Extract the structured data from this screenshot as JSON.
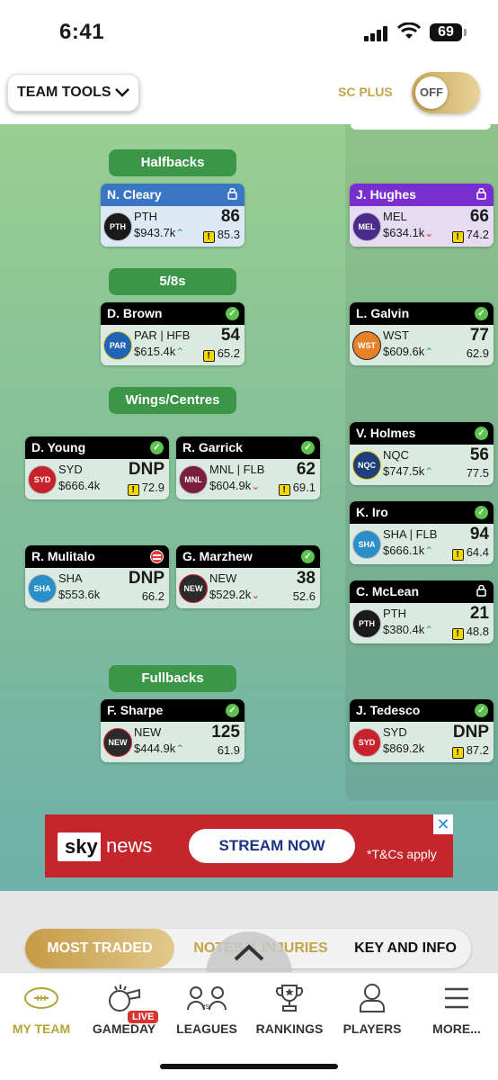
{
  "status": {
    "time": "6:41",
    "battery": "69"
  },
  "header": {
    "team_tools": "TEAM TOOLS",
    "sc_plus": "SC PLUS",
    "toggle": "OFF"
  },
  "positions": {
    "halfbacks": "Halfbacks",
    "five_eighths": "5/8s",
    "wings": "Wings/Centres",
    "fullbacks": "Fullbacks"
  },
  "players": {
    "cleary": {
      "name": "N. Cleary",
      "team": "PTH",
      "price": "$943.7k",
      "score": "86",
      "avg": "85.3"
    },
    "brown": {
      "name": "D. Brown",
      "team": "PAR | HFB",
      "price": "$615.4k",
      "score": "54",
      "avg": "65.2"
    },
    "young": {
      "name": "D. Young",
      "team": "SYD",
      "price": "$666.4k",
      "score": "DNP",
      "avg": "72.9"
    },
    "garrick": {
      "name": "R. Garrick",
      "team": "MNL | FLB",
      "price": "$604.9k",
      "score": "62",
      "avg": "69.1"
    },
    "mulitalo": {
      "name": "R. Mulitalo",
      "team": "SHA",
      "price": "$553.6k",
      "score": "DNP",
      "avg": "66.2"
    },
    "marzhew": {
      "name": "G. Marzhew",
      "team": "NEW",
      "price": "$529.2k",
      "score": "38",
      "avg": "52.6"
    },
    "sharpe": {
      "name": "F. Sharpe",
      "team": "NEW",
      "price": "$444.9k",
      "score": "125",
      "avg": "61.9"
    },
    "hughes": {
      "name": "J. Hughes",
      "team": "MEL",
      "price": "$634.1k",
      "score": "66",
      "avg": "74.2"
    },
    "galvin": {
      "name": "L. Galvin",
      "team": "WST",
      "price": "$609.6k",
      "score": "77",
      "avg": "62.9"
    },
    "holmes": {
      "name": "V. Holmes",
      "team": "NQC",
      "price": "$747.5k",
      "score": "56",
      "avg": "77.5"
    },
    "iro": {
      "name": "K. Iro",
      "team": "SHA | FLB",
      "price": "$666.1k",
      "score": "94",
      "avg": "64.4"
    },
    "mclean": {
      "name": "C. McLean",
      "team": "PTH",
      "price": "$380.4k",
      "score": "21",
      "avg": "48.8"
    },
    "tedesco": {
      "name": "J. Tedesco",
      "team": "SYD",
      "price": "$869.2k",
      "score": "DNP",
      "avg": "87.2"
    }
  },
  "ad": {
    "sky": "sky",
    "news": "news",
    "cta": "STREAM NOW",
    "terms": "*T&Cs apply",
    "close": "✕"
  },
  "tabs": {
    "most_traded": "MOST TRADED",
    "notes": "NOTES & INJURIES",
    "key": "KEY AND INFO"
  },
  "nav": [
    {
      "label": "MY TEAM",
      "icon": "football-icon"
    },
    {
      "label": "GAMEDAY",
      "icon": "whistle-icon",
      "badge": "LIVE"
    },
    {
      "label": "LEAGUES",
      "icon": "versus-icon"
    },
    {
      "label": "RANKINGS",
      "icon": "trophy-icon"
    },
    {
      "label": "PLAYERS",
      "icon": "player-icon"
    },
    {
      "label": "MORE...",
      "icon": "menu-icon"
    }
  ],
  "colors": {
    "accent_gold": "#c4a447",
    "position_green": "#3b9648",
    "ad_red": "#c4262b"
  }
}
